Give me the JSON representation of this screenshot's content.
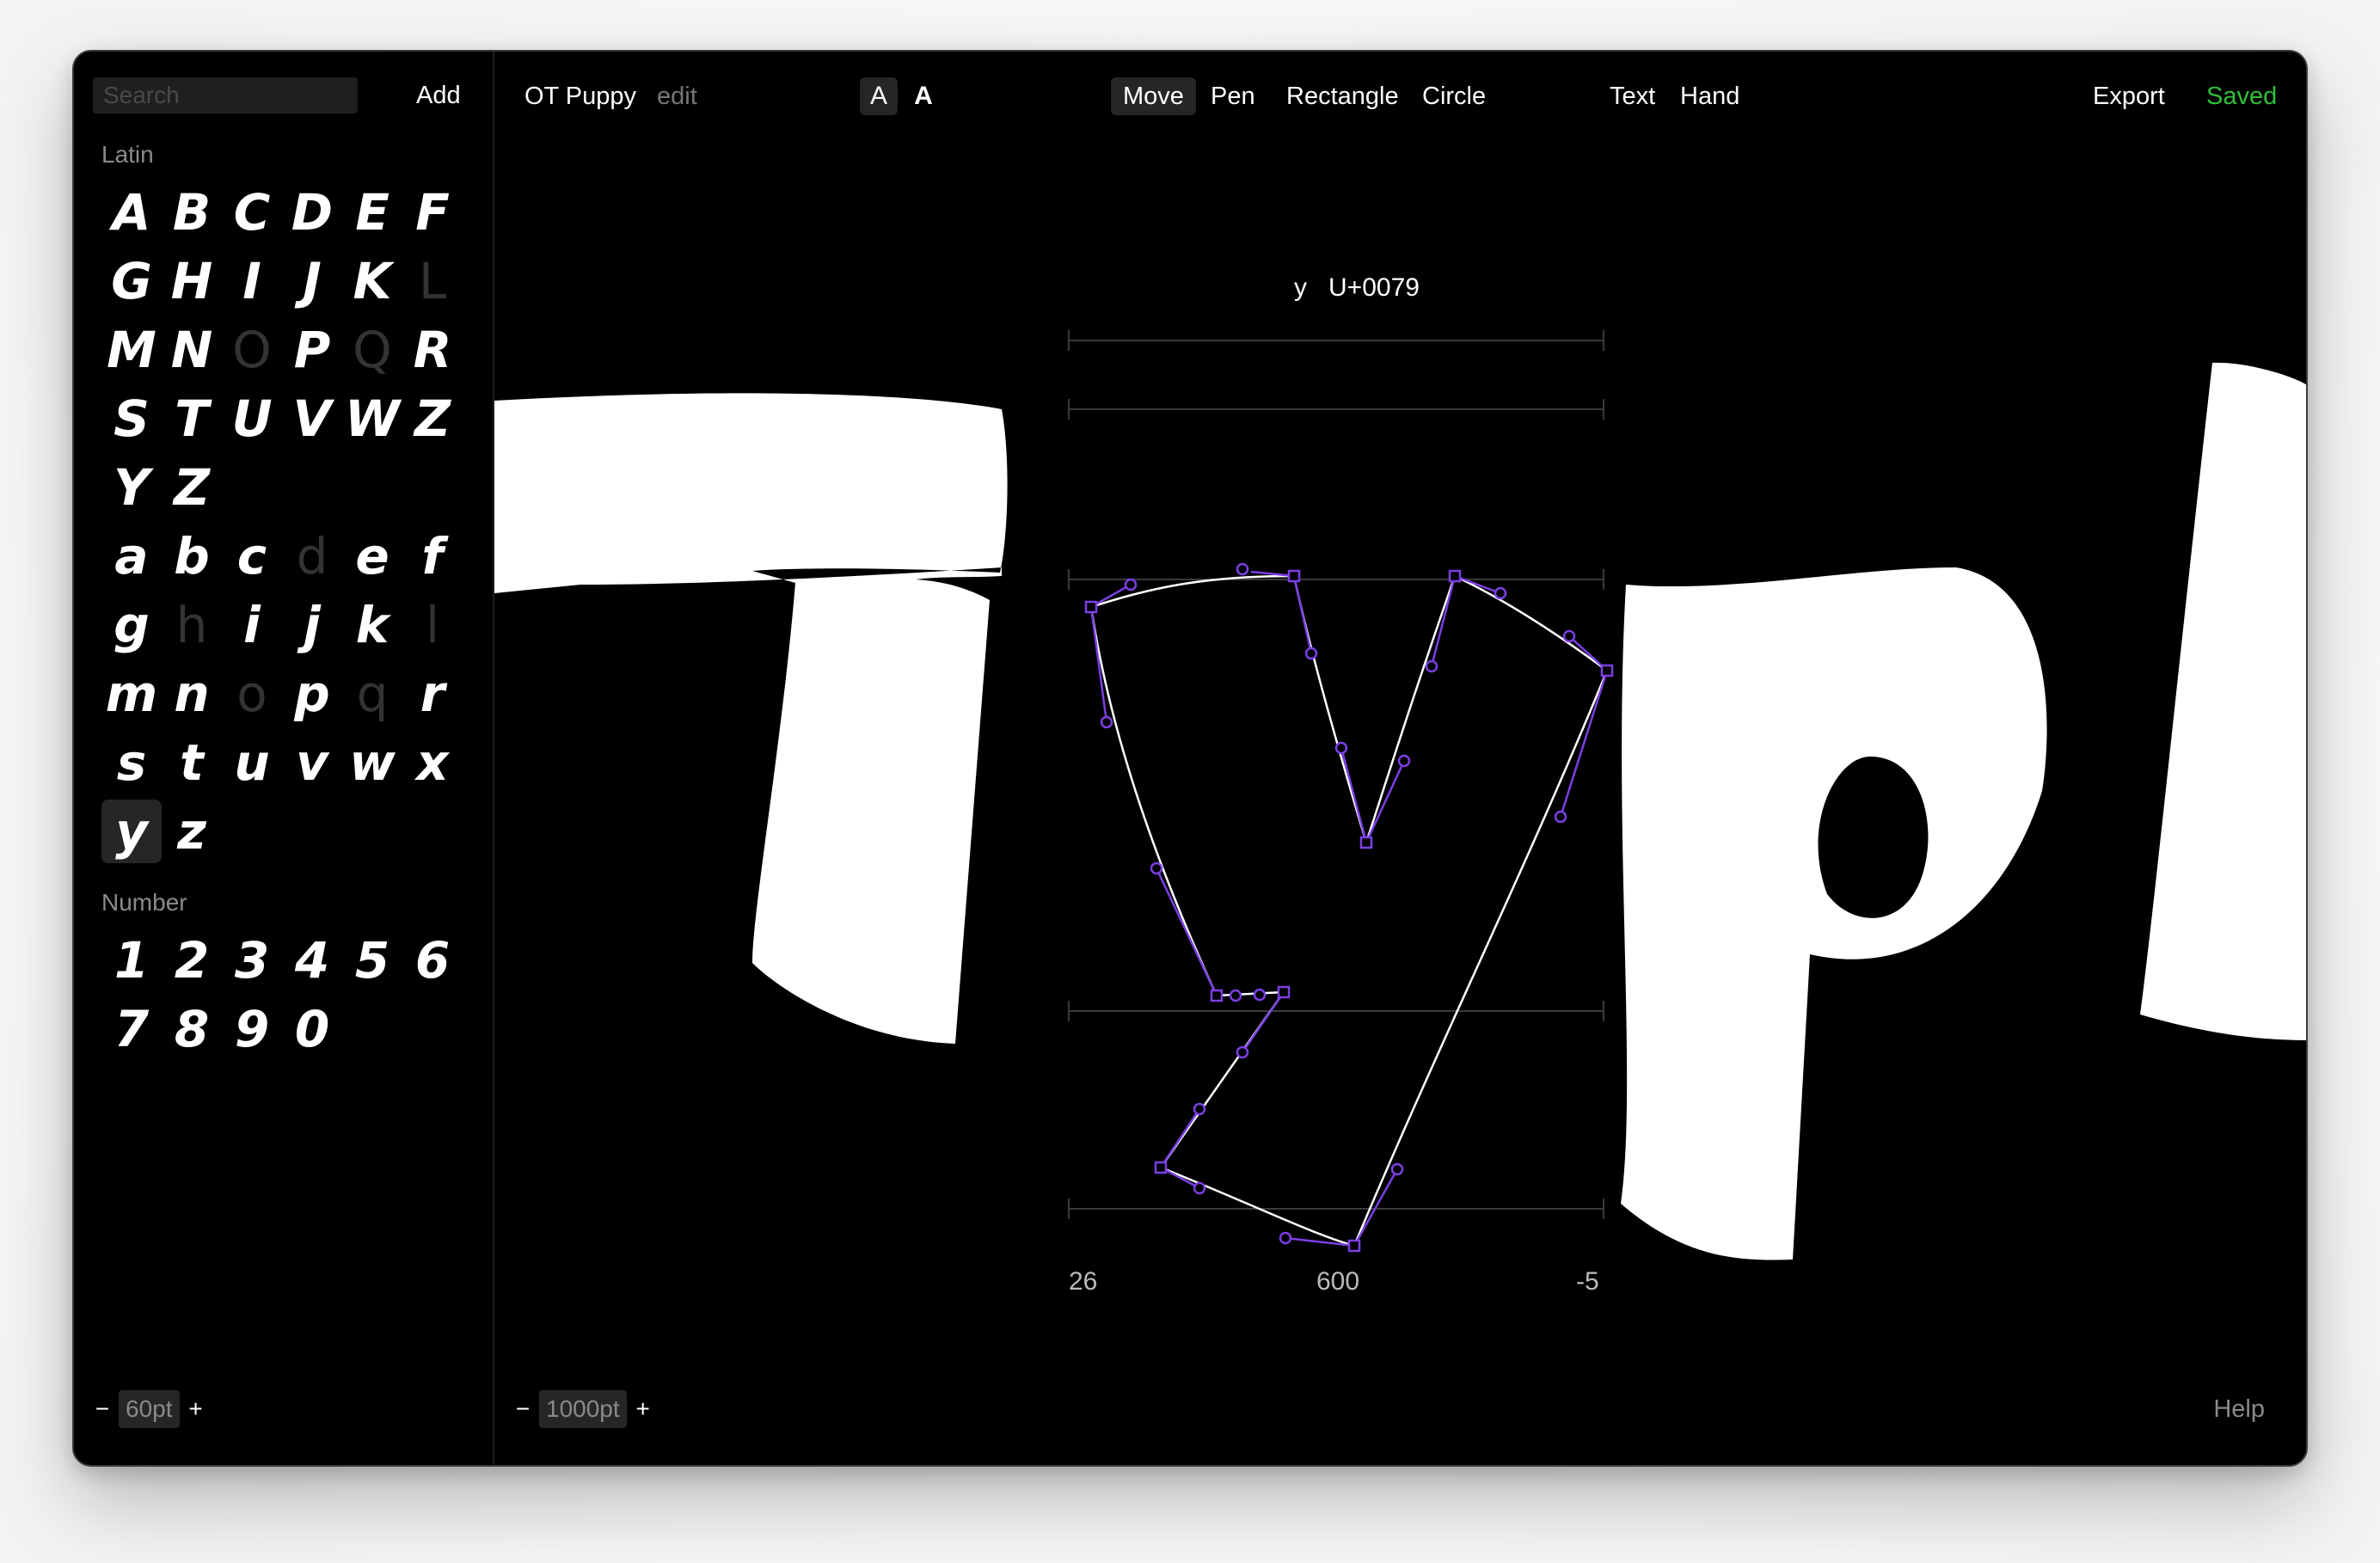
{
  "sidebar": {
    "search_placeholder": "Search",
    "add_label": "Add",
    "sections": [
      {
        "label": "Latin",
        "rows": [
          [
            {
              "ch": "A"
            },
            {
              "ch": "B"
            },
            {
              "ch": "C"
            },
            {
              "ch": "D"
            },
            {
              "ch": "E"
            },
            {
              "ch": "F"
            }
          ],
          [
            {
              "ch": "G"
            },
            {
              "ch": "H"
            },
            {
              "ch": "I"
            },
            {
              "ch": "J"
            },
            {
              "ch": "K"
            },
            {
              "ch": "L",
              "dim": true
            }
          ],
          [
            {
              "ch": "M"
            },
            {
              "ch": "N"
            },
            {
              "ch": "O",
              "dim": true
            },
            {
              "ch": "P"
            },
            {
              "ch": "Q",
              "dim": true
            },
            {
              "ch": "R"
            }
          ],
          [
            {
              "ch": "S"
            },
            {
              "ch": "T"
            },
            {
              "ch": "U"
            },
            {
              "ch": "V"
            },
            {
              "ch": "W"
            },
            {
              "ch": "Z"
            }
          ],
          [
            {
              "ch": "Y"
            },
            {
              "ch": "Z"
            }
          ],
          [
            {
              "ch": "a"
            },
            {
              "ch": "b"
            },
            {
              "ch": "c"
            },
            {
              "ch": "d",
              "dim": true
            },
            {
              "ch": "e"
            },
            {
              "ch": "f"
            }
          ],
          [
            {
              "ch": "g"
            },
            {
              "ch": "h",
              "dim": true
            },
            {
              "ch": "i"
            },
            {
              "ch": "j"
            },
            {
              "ch": "k"
            },
            {
              "ch": "l",
              "dim": true
            }
          ],
          [
            {
              "ch": "m"
            },
            {
              "ch": "n"
            },
            {
              "ch": "o",
              "dim": true
            },
            {
              "ch": "p"
            },
            {
              "ch": "q",
              "dim": true
            },
            {
              "ch": "r"
            }
          ],
          [
            {
              "ch": "s"
            },
            {
              "ch": "t"
            },
            {
              "ch": "u"
            },
            {
              "ch": "v"
            },
            {
              "ch": "w"
            },
            {
              "ch": "x"
            }
          ],
          [
            {
              "ch": "y",
              "selected": true
            },
            {
              "ch": "z"
            }
          ]
        ]
      },
      {
        "label": "Number",
        "rows": [
          [
            {
              "ch": "1"
            },
            {
              "ch": "2"
            },
            {
              "ch": "3"
            },
            {
              "ch": "4"
            },
            {
              "ch": "5"
            },
            {
              "ch": "6"
            }
          ],
          [
            {
              "ch": "7"
            },
            {
              "ch": "8"
            },
            {
              "ch": "9"
            },
            {
              "ch": "0"
            }
          ]
        ]
      }
    ],
    "zoom": {
      "minus": "−",
      "value": "60pt",
      "plus": "+"
    }
  },
  "toolbar": {
    "font_name": "OT Puppy",
    "edit_label": "edit",
    "style_a_regular": "A",
    "style_a_bold": "A",
    "tools": {
      "move": "Move",
      "pen": "Pen",
      "rectangle": "Rectangle",
      "circle": "Circle",
      "text": "Text",
      "hand": "Hand"
    },
    "active_tool": "Move",
    "export_label": "Export",
    "saved_label": "Saved"
  },
  "canvas": {
    "glyph_char": "y",
    "glyph_code": "U+0079",
    "metrics": {
      "left_bearing": "26",
      "advance": "600",
      "right_bearing": "-5"
    },
    "preview_text": "Typl",
    "zoom": {
      "minus": "−",
      "value": "1000pt",
      "plus": "+"
    },
    "help_label": "Help"
  },
  "colors": {
    "background": "#000000",
    "saved": "#2fbf3a",
    "control_point": "#7b3fe4",
    "outline": "#ffffff",
    "dim_glyph": "#333333"
  }
}
